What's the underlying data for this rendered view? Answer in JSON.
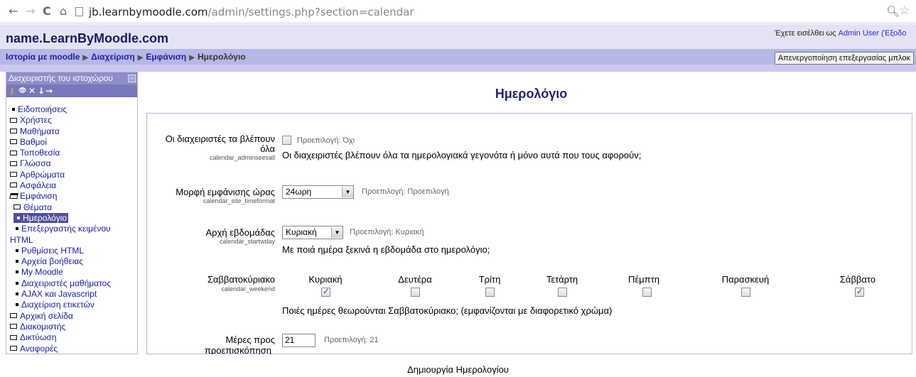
{
  "browser": {
    "url_host": "jb.learnbymoodle.com",
    "url_rest": "/admin/settings.php?section=calendar"
  },
  "header": {
    "site_name": "name.LearnByMoodle.com",
    "login_prefix": "Έχετε εισέλθει ως",
    "login_user": "Admin User (Έξοδο"
  },
  "navbar": {
    "crumbs": [
      "Ιστορία με moodle",
      "Διαχείριση",
      "Εμφάνιση",
      "Ημερολόγιο"
    ],
    "block_edit_button": "Απενεργοποίηση επεξεργασίας μπλοκ"
  },
  "sidebar": {
    "title": "Διαχειριστής του ιστοχώρου",
    "collapse": "−",
    "items": [
      {
        "label": "Ειδοποιήσεις",
        "type": "leaf"
      },
      {
        "label": "Χρήστες",
        "type": "folder"
      },
      {
        "label": "Μαθήματα",
        "type": "folder"
      },
      {
        "label": "Βαθμοί",
        "type": "folder"
      },
      {
        "label": "Τοποθεσία",
        "type": "folder"
      },
      {
        "label": "Γλώσσα",
        "type": "folder"
      },
      {
        "label": "Αρθρώματα",
        "type": "folder"
      },
      {
        "label": "Ασφάλεια",
        "type": "folder"
      },
      {
        "label": "Εμφάνιση",
        "type": "folder-open"
      },
      {
        "label": "Θέματα",
        "type": "folder"
      },
      {
        "label": "Ημερολόγιο",
        "type": "leaf",
        "selected": true
      },
      {
        "label": "Επεξεργαστής κειμένου",
        "type": "leaf"
      },
      {
        "label": "HTML",
        "type": "cont"
      },
      {
        "label": "Ρυθμίσεις HTML",
        "type": "leaf"
      },
      {
        "label": "Αρχεία βοήθειας",
        "type": "leaf"
      },
      {
        "label": "My Moodle",
        "type": "leaf"
      },
      {
        "label": "Διαχειριστές μαθήματος",
        "type": "leaf"
      },
      {
        "label": "AJAX και Javascript",
        "type": "leaf"
      },
      {
        "label": "Διαχείριση ετικετών",
        "type": "leaf"
      },
      {
        "label": "Αρχική σελίδα",
        "type": "folder"
      },
      {
        "label": "Διακομιστής",
        "type": "folder"
      },
      {
        "label": "Δικτύωση",
        "type": "folder"
      },
      {
        "label": "Αναφορές",
        "type": "folder"
      }
    ]
  },
  "main": {
    "title": "Ημερολόγιο",
    "settings": {
      "adminseesall": {
        "label_line1": "Οι διαχειριστές τα βλέπουν",
        "label_line2": "όλα",
        "key": "calendar_adminseesall",
        "default": "Προεπιλογή: Όχι",
        "checked": false,
        "description": "Οι διαχειριστές βλέπουν όλα τα ημερολογιακά γεγονότα ή μόνο αυτά που τους αφορούν;"
      },
      "timeformat": {
        "label": "Μορφή εμφάνισης ώρας",
        "key": "calendar_site_timeformat",
        "value": "24ωρη",
        "default": "Προεπιλογή: Προεπιλογή"
      },
      "startwday": {
        "label": "Αρχή εβδομάδας",
        "key": "calendar_startwday",
        "value": "Κυριακή",
        "default": "Προεπιλογή: Κυριακή",
        "description": "Με ποιά ημέρα ξεκινά η εβδομάδα στο ημερολόγιο;"
      },
      "weekend": {
        "label": "Σαββατοκύριακο",
        "key": "calendar_weekend",
        "days": [
          {
            "name": "Κυριακή",
            "checked": true
          },
          {
            "name": "Δευτέρα",
            "checked": false
          },
          {
            "name": "Τρίτη",
            "checked": false
          },
          {
            "name": "Τετάρτη",
            "checked": false
          },
          {
            "name": "Πέμπτη",
            "checked": false
          },
          {
            "name": "Παρασκευή",
            "checked": false
          },
          {
            "name": "Σάββατο",
            "checked": true
          }
        ],
        "description": "Ποιές ημέρες θεωρούνται Σαββατοκύριακο; (εμφανίζονται με διαφορετικό χρώμα)"
      },
      "lookahead": {
        "label_line1": "Μέρες προς",
        "label_line2": "προεπισκόπηση",
        "value": "21",
        "default": "Προεπιλογή: 21"
      }
    }
  },
  "caption": "Δημιουργία Ημερολογίου"
}
